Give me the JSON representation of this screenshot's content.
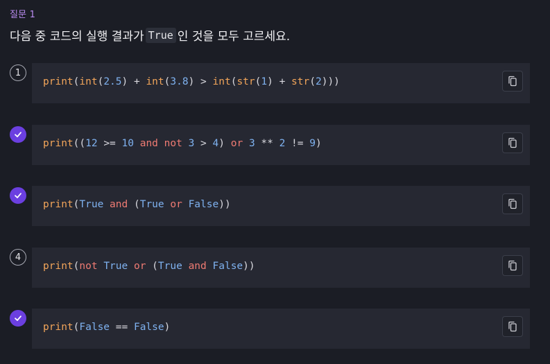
{
  "question": {
    "label": "질문 1",
    "text_before": "다음 중 코드의 실행 결과가 ",
    "inline_code": "True",
    "text_after": "인 것을 모두 고르세요."
  },
  "colors": {
    "accent": "#6b3fe0",
    "label": "#b98cf0",
    "function": "#f2a55a",
    "number": "#7fb2f0",
    "keyword": "#ef7b73"
  },
  "options": [
    {
      "marker": "1",
      "checked": false,
      "icon": "copy-icon",
      "code": [
        {
          "t": "print",
          "k": "fn"
        },
        {
          "t": "(",
          "k": "p"
        },
        {
          "t": "int",
          "k": "fn"
        },
        {
          "t": "(",
          "k": "p"
        },
        {
          "t": "2.5",
          "k": "num"
        },
        {
          "t": ") + ",
          "k": "p"
        },
        {
          "t": "int",
          "k": "fn"
        },
        {
          "t": "(",
          "k": "p"
        },
        {
          "t": "3.8",
          "k": "num"
        },
        {
          "t": ") > ",
          "k": "p"
        },
        {
          "t": "int",
          "k": "fn"
        },
        {
          "t": "(",
          "k": "p"
        },
        {
          "t": "str",
          "k": "fn"
        },
        {
          "t": "(",
          "k": "p"
        },
        {
          "t": "1",
          "k": "num"
        },
        {
          "t": ") + ",
          "k": "p"
        },
        {
          "t": "str",
          "k": "fn"
        },
        {
          "t": "(",
          "k": "p"
        },
        {
          "t": "2",
          "k": "num"
        },
        {
          "t": ")))",
          "k": "p"
        }
      ]
    },
    {
      "marker": "",
      "checked": true,
      "icon": "copy-icon",
      "code": [
        {
          "t": "print",
          "k": "fn"
        },
        {
          "t": "((",
          "k": "p"
        },
        {
          "t": "12",
          "k": "num"
        },
        {
          "t": " >= ",
          "k": "p"
        },
        {
          "t": "10",
          "k": "num"
        },
        {
          "t": " ",
          "k": "p"
        },
        {
          "t": "and",
          "k": "kw"
        },
        {
          "t": " ",
          "k": "p"
        },
        {
          "t": "not",
          "k": "kw"
        },
        {
          "t": " ",
          "k": "p"
        },
        {
          "t": "3",
          "k": "num"
        },
        {
          "t": " > ",
          "k": "p"
        },
        {
          "t": "4",
          "k": "num"
        },
        {
          "t": ") ",
          "k": "p"
        },
        {
          "t": "or",
          "k": "kw"
        },
        {
          "t": " ",
          "k": "p"
        },
        {
          "t": "3",
          "k": "num"
        },
        {
          "t": " ** ",
          "k": "p"
        },
        {
          "t": "2",
          "k": "num"
        },
        {
          "t": " != ",
          "k": "p"
        },
        {
          "t": "9",
          "k": "num"
        },
        {
          "t": ")",
          "k": "p"
        }
      ]
    },
    {
      "marker": "",
      "checked": true,
      "icon": "copy-icon",
      "code": [
        {
          "t": "print",
          "k": "fn"
        },
        {
          "t": "(",
          "k": "p"
        },
        {
          "t": "True",
          "k": "bool"
        },
        {
          "t": " ",
          "k": "p"
        },
        {
          "t": "and",
          "k": "kw"
        },
        {
          "t": " (",
          "k": "p"
        },
        {
          "t": "True",
          "k": "bool"
        },
        {
          "t": " ",
          "k": "p"
        },
        {
          "t": "or",
          "k": "kw"
        },
        {
          "t": " ",
          "k": "p"
        },
        {
          "t": "False",
          "k": "bool"
        },
        {
          "t": "))",
          "k": "p"
        }
      ]
    },
    {
      "marker": "4",
      "checked": false,
      "icon": "copy-icon",
      "code": [
        {
          "t": "print",
          "k": "fn"
        },
        {
          "t": "(",
          "k": "p"
        },
        {
          "t": "not",
          "k": "kw"
        },
        {
          "t": " ",
          "k": "p"
        },
        {
          "t": "True",
          "k": "bool"
        },
        {
          "t": " ",
          "k": "p"
        },
        {
          "t": "or",
          "k": "kw"
        },
        {
          "t": " (",
          "k": "p"
        },
        {
          "t": "True",
          "k": "bool"
        },
        {
          "t": " ",
          "k": "p"
        },
        {
          "t": "and",
          "k": "kw"
        },
        {
          "t": " ",
          "k": "p"
        },
        {
          "t": "False",
          "k": "bool"
        },
        {
          "t": "))",
          "k": "p"
        }
      ]
    },
    {
      "marker": "",
      "checked": true,
      "icon": "copy-icon",
      "code": [
        {
          "t": "print",
          "k": "fn"
        },
        {
          "t": "(",
          "k": "p"
        },
        {
          "t": "False",
          "k": "bool"
        },
        {
          "t": " == ",
          "k": "p"
        },
        {
          "t": "False",
          "k": "bool"
        },
        {
          "t": ")",
          "k": "p"
        }
      ]
    }
  ]
}
